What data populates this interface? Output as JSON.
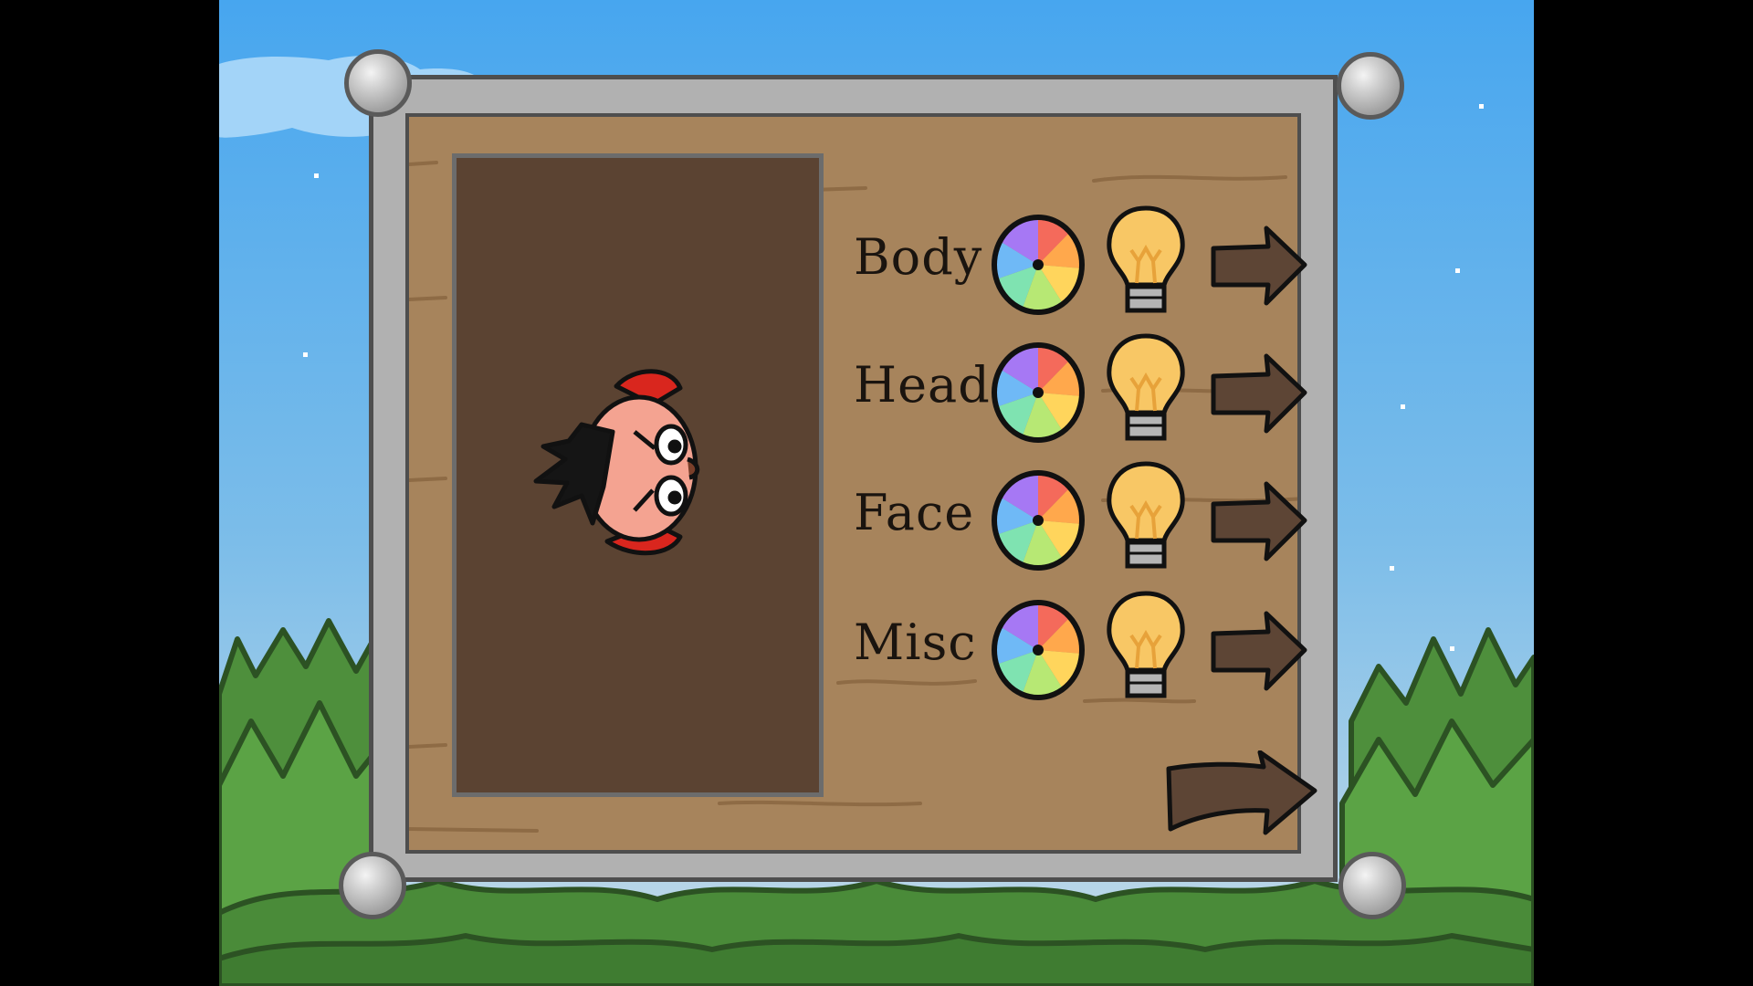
{
  "screen": "character-customization",
  "options": [
    {
      "label": "Body",
      "color_icon": "color-wheel-icon",
      "random_icon": "lightbulb-icon",
      "next_icon": "arrow-right-icon"
    },
    {
      "label": "Head",
      "color_icon": "color-wheel-icon",
      "random_icon": "lightbulb-icon",
      "next_icon": "arrow-right-icon"
    },
    {
      "label": "Face",
      "color_icon": "color-wheel-icon",
      "random_icon": "lightbulb-icon",
      "next_icon": "arrow-right-icon"
    },
    {
      "label": "Misc",
      "color_icon": "color-wheel-icon",
      "random_icon": "lightbulb-icon",
      "next_icon": "arrow-right-icon"
    }
  ],
  "confirm_icon": "arrow-right-icon",
  "colors": {
    "sky_top": "#47a6ef",
    "sky_bottom": "#b9d6ea",
    "wood": "#a7845c",
    "preview_bg": "#5b4332",
    "frame_metal": "#b1b1b1",
    "arrow_fill": "#5d4535",
    "bulb_glow": "#f8c765",
    "tree_green": "#4e8f3c"
  }
}
